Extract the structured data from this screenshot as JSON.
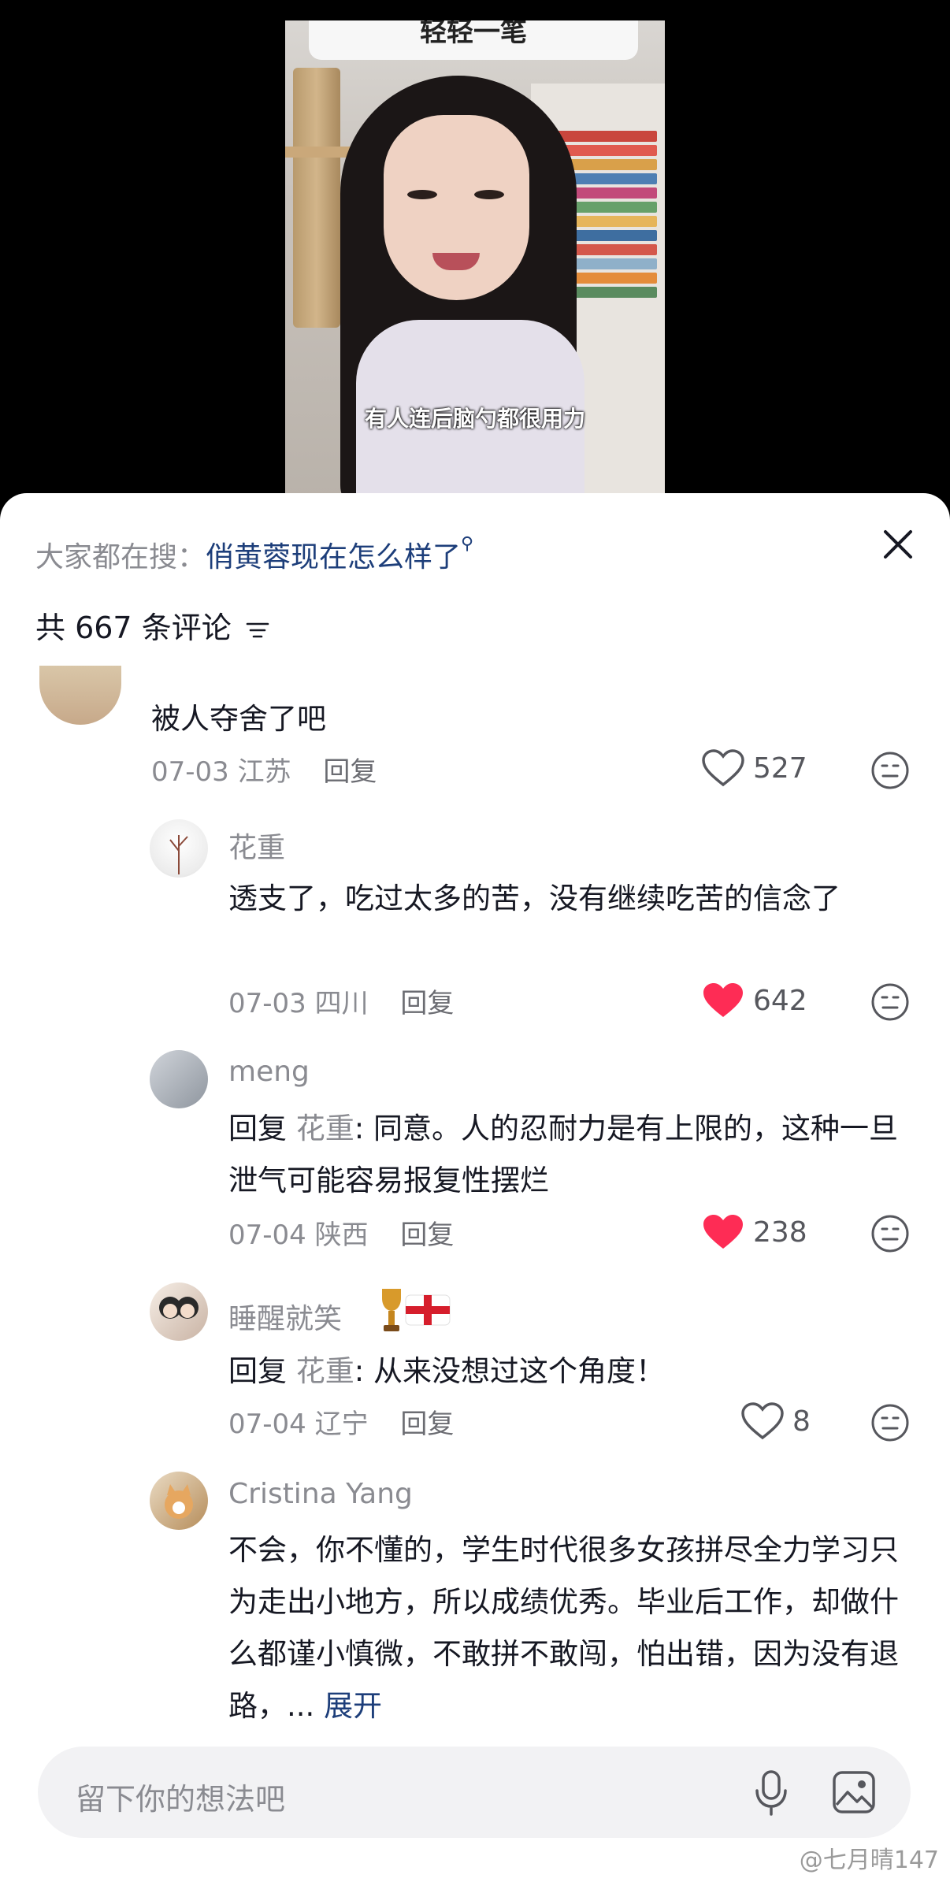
{
  "video": {
    "title_card": "轻轻一笔",
    "subtitle": "有人连后脑勺都很用力"
  },
  "search_suggest": {
    "prefix": "大家都在搜：",
    "keyword": "俏黄蓉现在怎么样了"
  },
  "comment_count": "共 667 条评论",
  "comments": [
    {
      "text": "被人夺舍了吧",
      "date": "07-03",
      "location": "江苏",
      "reply_label": "回复",
      "likes": "527",
      "liked": false
    },
    {
      "name": "花重",
      "text": "透支了，吃过太多的苦，没有继续吃苦的信念了",
      "date": "07-03",
      "location": "四川",
      "reply_label": "回复",
      "likes": "642",
      "liked": true
    },
    {
      "name": "meng",
      "reply_prefix": "回复",
      "mention": "花重",
      "text": ": 同意。人的忍耐力是有上限的，这种一旦泄气可能容易报复性摆烂",
      "date": "07-04",
      "location": "陕西",
      "reply_label": "回复",
      "likes": "238",
      "liked": true
    },
    {
      "name": "睡醒就笑",
      "reply_prefix": "回复",
      "mention": "花重",
      "text": ": 从来没想过这个角度！",
      "date": "07-04",
      "location": "辽宁",
      "reply_label": "回复",
      "likes": "8",
      "liked": false
    },
    {
      "name": "Cristina Yang",
      "text": "不会，你不懂的，学生时代很多女孩拼尽全力学习只为走出小地方，所以成绩优秀。毕业后工作，却做什么都谨小慎微，不敢拼不敢闯，怕出错，因为没有退路，...",
      "more": "展开"
    }
  ],
  "input": {
    "placeholder": "留下你的想法吧"
  },
  "watermark": "@七月晴147",
  "colors": {
    "like_red": "#fe2c55",
    "link_blue": "#1d3e7a",
    "muted": "#8a8b91"
  }
}
